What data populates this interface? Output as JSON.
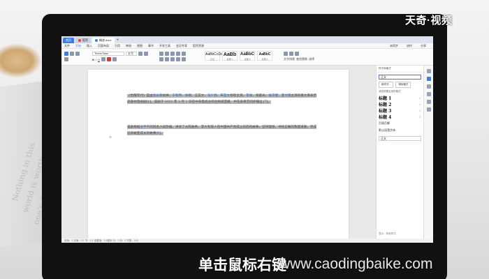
{
  "logo": "天奇·视频",
  "caption": "单击鼠标右键",
  "watermark_site": "www.caodingbaike.com",
  "background": {
    "book_text_lines": [
      "Nothing in this",
      "world is worth",
      "one's dear life"
    ]
  },
  "app": {
    "tabs": [
      {
        "label": "首页",
        "style": "home"
      },
      {
        "label": "稻壳",
        "style": "normal",
        "dot_color": "#e0463b"
      },
      {
        "label": "概述.docx",
        "style": "active",
        "dot_color": "#3b7de1"
      }
    ],
    "tab_add": "+",
    "menu": [
      "文件",
      "开始",
      "插入",
      "页面布局",
      "引用",
      "审阅",
      "视图",
      "章节",
      "开发工具",
      "会员专享",
      "稻壳资源"
    ],
    "menu_active_index": 1,
    "menu_right": [
      "未同步",
      "协作",
      "分享"
    ],
    "ribbon": {
      "font_name": "Times New",
      "font_size": "五号",
      "styles": [
        {
          "sample": "AaBbCcDd",
          "name": "正文"
        },
        {
          "sample": "AaBb",
          "name": "标题 1"
        },
        {
          "sample": "AaBbC",
          "name": "标题 2"
        },
        {
          "sample": "AaBbC",
          "name": "标题 3"
        }
      ],
      "right_labels": [
        "文字排版",
        "查找替换",
        "选择"
      ]
    }
  },
  "document": {
    "paragraph1": [
      {
        "text": "《觉醒年代》是由",
        "c": ""
      },
      {
        "text": "张永新",
        "c": "blue"
      },
      {
        "text": "执导，",
        "c": ""
      },
      {
        "text": "于和伟",
        "c": "blue"
      },
      {
        "text": "、",
        "c": ""
      },
      {
        "text": "张桐",
        "c": "blue"
      },
      {
        "text": "、王志文、",
        "c": ""
      },
      {
        "text": "马少骅",
        "c": "blue"
      },
      {
        "text": "、",
        "c": ""
      },
      {
        "text": "朱亚文",
        "c": "blue"
      },
      {
        "text": "领衔主演，",
        "c": ""
      },
      {
        "text": "李易",
        "c": "blue"
      },
      {
        "text": "、张晨光、",
        "c": ""
      },
      {
        "text": "侯京健",
        "c": "blue"
      },
      {
        "text": "、",
        "c": ""
      },
      {
        "text": "夏文锦",
        "c": "blue"
      },
      {
        "text": "主演的重大革命历史题材电视剧[1]。该剧于 2021 年 2 月 1 日在中央电视台综合频道首播，并在爱奇艺同步播出 [7]。",
        "c": ""
      }
    ],
    "paragraph2": [
      {
        "text": "该剧根据",
        "c": ""
      },
      {
        "text": "龙平平",
        "c": "blue"
      },
      {
        "text": "的同名小说改编，讲述了从陈独秀、李大钊等人在中国共产党成立前后的故事，坚持理想，寻找正确的救国道路，完成信仰蜕变成长的故事",
        "c": ""
      },
      {
        "text": "[8]",
        "c": "blue"
      },
      {
        "text": "。",
        "c": ""
      }
    ]
  },
  "style_panel": {
    "title": "样式和格式",
    "current_style": "正文",
    "buttons": [
      "新样式...",
      "清除格式"
    ],
    "sub_label": "请选择要应用的格式",
    "headings": [
      "标题 1",
      "标题 2",
      "标题 3",
      "标题 4"
    ],
    "extra_items": [
      "页眉页脚",
      "默认段落字体",
      "正文"
    ],
    "footer": "显示：有效样式"
  },
  "statusbar": "页码：1 页面：1/1 节：1/1 设置值：2.5厘米 行：1 列：1 字数：143"
}
